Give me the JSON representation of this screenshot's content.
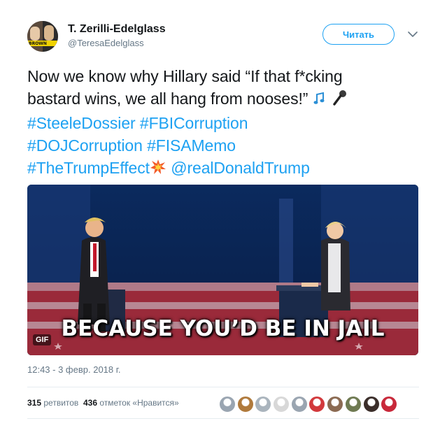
{
  "header": {
    "fullname": "T. Zerilli-Edelglass",
    "handle": "@TeresaEdelglass",
    "avatar_badge": "BROWN",
    "follow_label": "Читать"
  },
  "tweet": {
    "line1": "Now we know why Hillary said “If that f*cking",
    "line2": "bastard wins, we all hang from nooses!” ",
    "hashtags": {
      "steele": "#SteeleDossier",
      "fbi": "#FBICorruption",
      "doj": "#DOJCorruption",
      "fisa": "#FISAMemo",
      "trump_effect": "#TheTrumpEffect"
    },
    "mention": "@realDonaldTrump",
    "emoji": {
      "music": "🎶",
      "mic": "🎤",
      "boom": "💥"
    }
  },
  "media": {
    "caption": "BECAUSE YOU’D BE IN JAIL",
    "badge": "GIF"
  },
  "timestamp": "12:43 - 3 февр. 2018 г.",
  "stats": {
    "retweets_count": "315",
    "retweets_label": "ретвитов",
    "likes_count": "436",
    "likes_label": "отметок «Нравится»"
  },
  "likers": [
    {
      "name": "liker-1",
      "color": "#9aa5b1"
    },
    {
      "name": "liker-2",
      "color": "#b07a3c"
    },
    {
      "name": "liker-3",
      "color": "#aab4bd"
    },
    {
      "name": "liker-4",
      "color": "#d8d8d8"
    },
    {
      "name": "liker-5",
      "color": "#9aa5b1"
    },
    {
      "name": "liker-6",
      "color": "#d2393c"
    },
    {
      "name": "liker-7",
      "color": "#8b6a52"
    },
    {
      "name": "liker-8",
      "color": "#6f7a52"
    },
    {
      "name": "liker-9",
      "color": "#3b2e2a"
    },
    {
      "name": "liker-10",
      "color": "#c8283a"
    }
  ],
  "colors": {
    "link": "#1da1f2",
    "text": "#14171a",
    "muted": "#657786"
  }
}
